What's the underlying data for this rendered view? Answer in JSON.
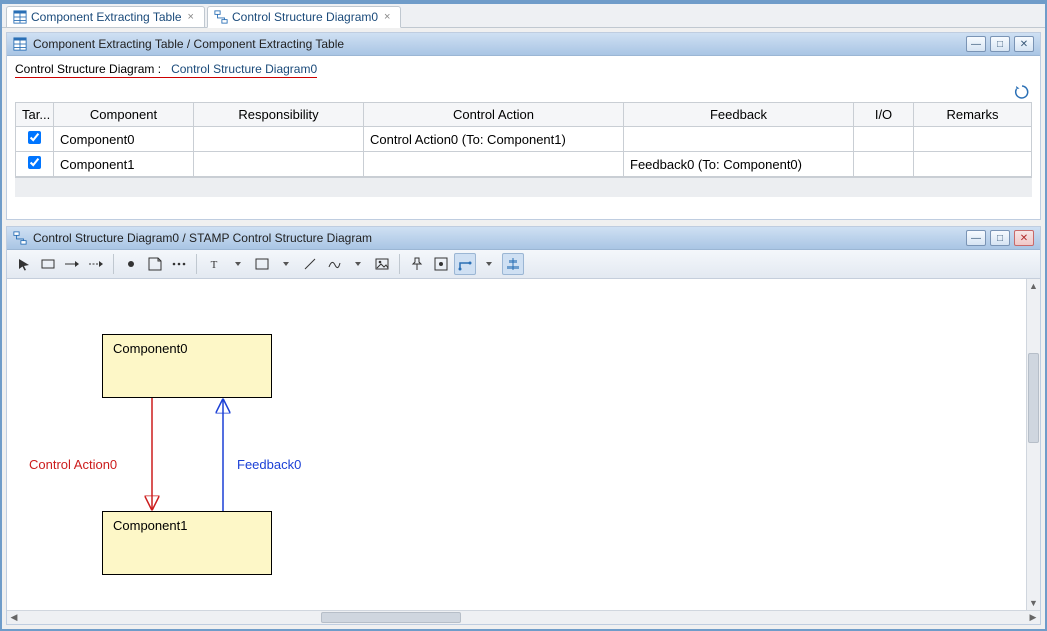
{
  "tabs": [
    {
      "label": "Component Extracting Table",
      "icon": "cet"
    },
    {
      "label": "Control Structure Diagram0",
      "icon": "csd"
    }
  ],
  "cet_panel": {
    "title": "Component Extracting Table / Component Extracting Table",
    "link_prefix": "Control Structure Diagram :",
    "link_value": "Control Structure Diagram0",
    "columns": {
      "target": "Tar...",
      "component": "Component",
      "responsibility": "Responsibility",
      "control_action": "Control Action",
      "feedback": "Feedback",
      "io": "I/O",
      "remarks": "Remarks"
    },
    "rows": [
      {
        "target": true,
        "component": "Component0",
        "responsibility": "",
        "control_action": "Control Action0 (To: Component1)",
        "feedback": "",
        "io": "",
        "remarks": ""
      },
      {
        "target": true,
        "component": "Component1",
        "responsibility": "",
        "control_action": "",
        "feedback": "Feedback0 (To: Component0)",
        "io": "",
        "remarks": ""
      }
    ]
  },
  "diag_panel": {
    "title": "Control Structure Diagram0 / STAMP Control Structure Diagram",
    "components": {
      "c0": "Component0",
      "c1": "Component1"
    },
    "labels": {
      "control_action": "Control Action0",
      "feedback": "Feedback0"
    }
  }
}
